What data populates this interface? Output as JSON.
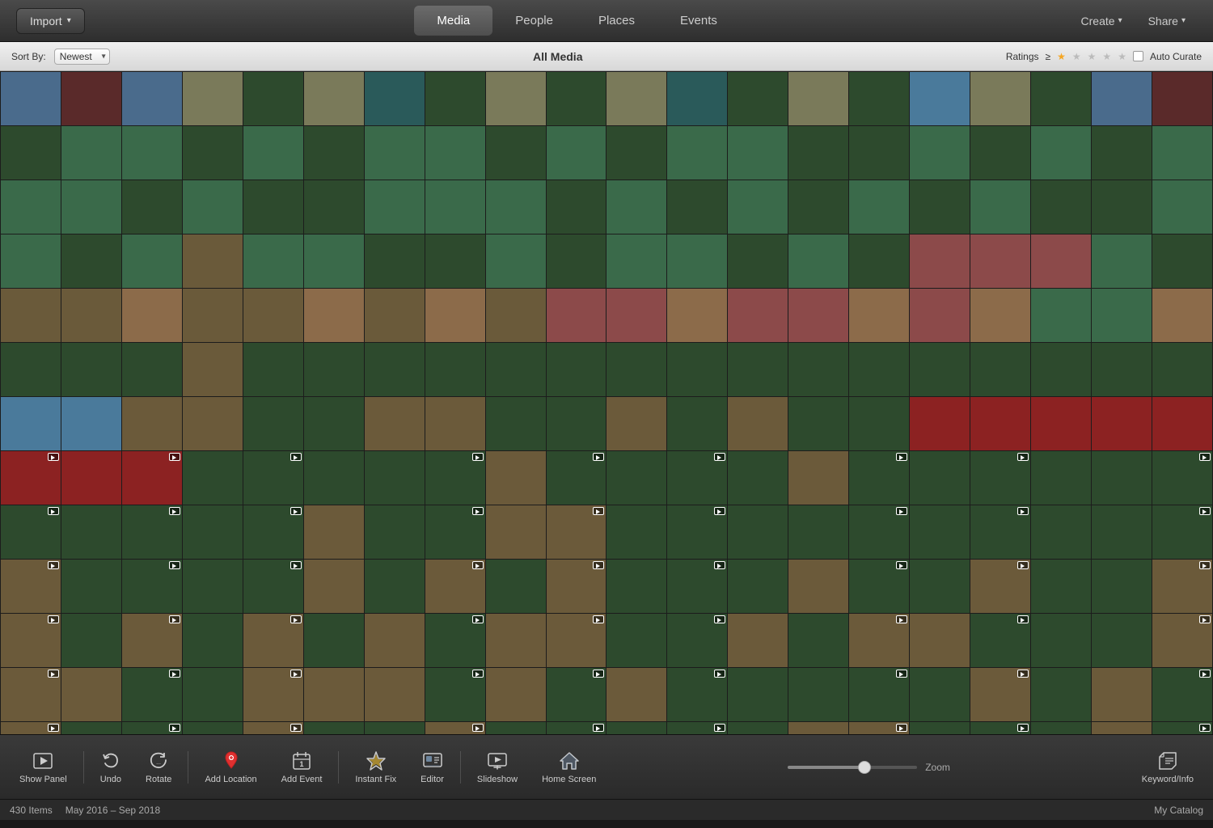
{
  "header": {
    "import_label": "Import",
    "tabs": [
      {
        "id": "media",
        "label": "Media",
        "active": true
      },
      {
        "id": "people",
        "label": "People",
        "active": false
      },
      {
        "id": "places",
        "label": "Places",
        "active": false
      },
      {
        "id": "events",
        "label": "Events",
        "active": false
      }
    ],
    "create_label": "Create",
    "share_label": "Share"
  },
  "toolbar": {
    "sort_label": "Sort By:",
    "sort_value": "Newest",
    "center_label": "All Media",
    "ratings_label": "Ratings",
    "ratings_sign": "≥",
    "auto_curate_label": "Auto Curate"
  },
  "bottom_toolbar": {
    "tools": [
      {
        "id": "show-panel",
        "label": "Show Panel",
        "icon": "▶"
      },
      {
        "id": "undo",
        "label": "Undo",
        "icon": "↩"
      },
      {
        "id": "rotate",
        "label": "Rotate",
        "icon": "↻"
      },
      {
        "id": "add-location",
        "label": "Add Location",
        "icon": "📍"
      },
      {
        "id": "add-event",
        "label": "Add Event",
        "icon": "📅"
      },
      {
        "id": "instant-fix",
        "label": "Instant Fix",
        "icon": "⚡"
      },
      {
        "id": "editor",
        "label": "Editor",
        "icon": "🖼"
      },
      {
        "id": "slideshow",
        "label": "Slideshow",
        "icon": "▶"
      },
      {
        "id": "home-screen",
        "label": "Home Screen",
        "icon": "🏠"
      }
    ],
    "zoom_label": "Zoom",
    "keyword_info_label": "Keyword/Info"
  },
  "status_bar": {
    "items_count": "430 Items",
    "date_range": "May 2016 – Sep 2018",
    "catalog": "My Catalog"
  },
  "photo_grid": {
    "total": 430
  }
}
